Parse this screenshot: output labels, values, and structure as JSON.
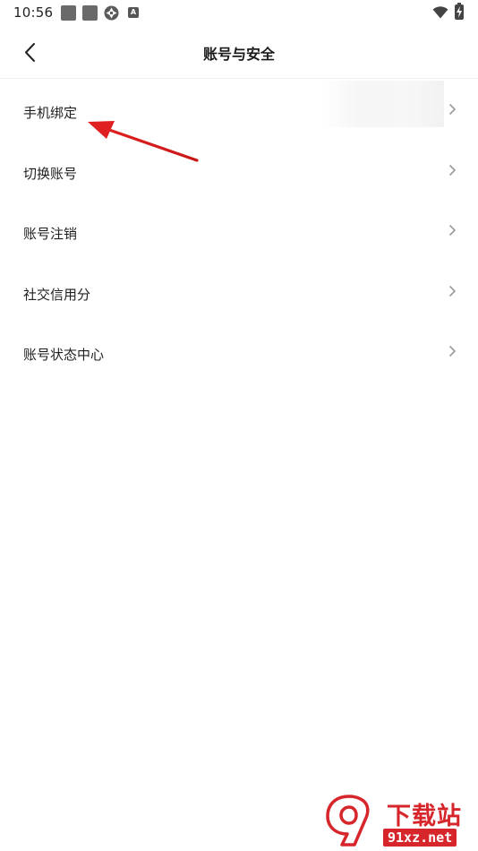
{
  "status_bar": {
    "time": "10:56",
    "icons": [
      "notification-square-icon",
      "notification-square-icon",
      "aperture-icon",
      "a-badge-icon",
      "wifi-icon",
      "battery-charging-icon"
    ],
    "a_badge": "A"
  },
  "header": {
    "back_icon": "chevron-left-icon",
    "title": "账号与安全"
  },
  "menu": {
    "items": [
      {
        "label": "手机绑定"
      },
      {
        "label": "切换账号"
      },
      {
        "label": "账号注销"
      },
      {
        "label": "社交信用分"
      },
      {
        "label": "账号状态中心"
      }
    ],
    "trailing_icon": "chevron-right-icon"
  },
  "annotation": {
    "arrow_color": "#e02020"
  },
  "watermark": {
    "title": "下载站",
    "domain": "91xz.net",
    "color": "#d6262b"
  },
  "colors": {
    "background": "#ffffff",
    "text": "#1f1f1f",
    "chevron": "#9a9a9a",
    "divider": "#f0f0f0"
  }
}
